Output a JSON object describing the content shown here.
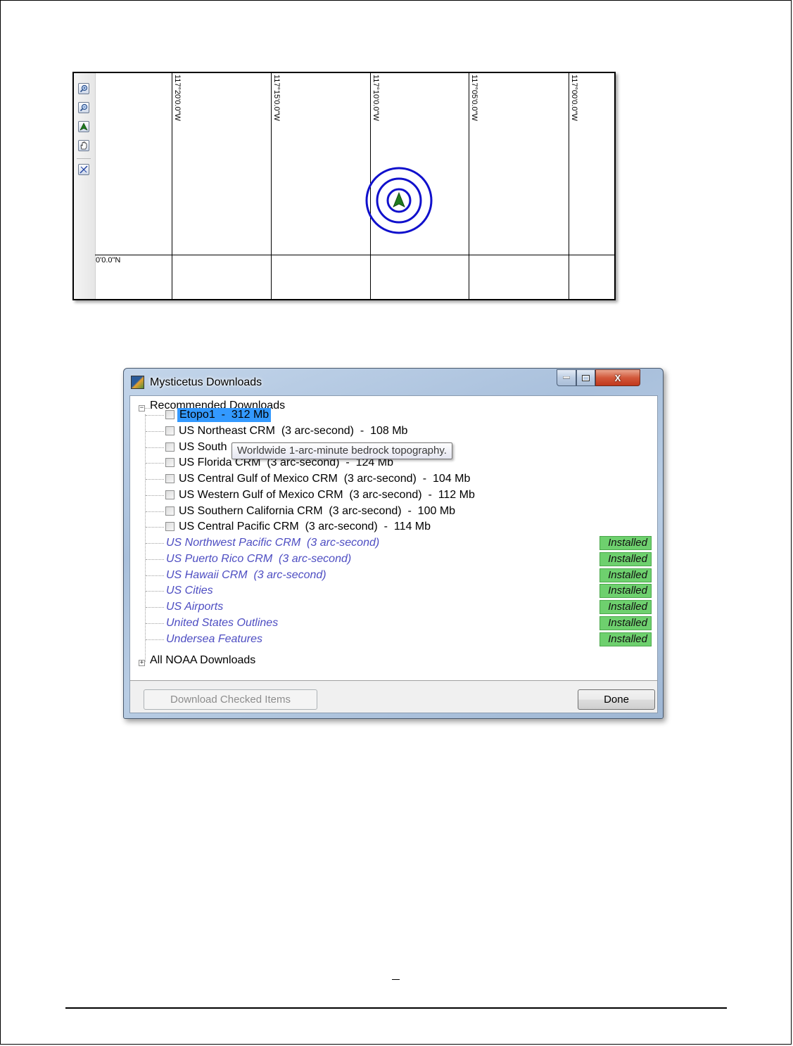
{
  "map": {
    "longitude_labels": [
      "117°20'0.0\"W",
      "117°15'0.0\"W",
      "117°10'0.0\"W",
      "117°05'0.0\"W",
      "117°00'0.0\"W"
    ],
    "latitude_label": "0'0.0\"N",
    "toolbar_icons": [
      "zoom-in-icon",
      "zoom-out-icon",
      "center-marker-icon",
      "pan-hand-icon",
      "measure-icon"
    ],
    "marker": {
      "color": "#1e7a1e",
      "ring_color": "#1010cc"
    }
  },
  "dialog": {
    "title": "Mysticetus Downloads",
    "tree": {
      "root_label": "Recommended Downloads",
      "tooltip": "Worldwide 1-arc-minute bedrock topography.",
      "items": [
        {
          "label": "Etopo1  -  312 Mb",
          "selected": true
        },
        {
          "label": "US Northeast CRM  (3 arc-second)  -  108 Mb"
        },
        {
          "label": "US South"
        },
        {
          "label": "US Florida CRM  (3 arc-second)  -  124 Mb"
        },
        {
          "label": "US Central Gulf of Mexico CRM  (3 arc-second)  -  104 Mb"
        },
        {
          "label": "US Western Gulf of Mexico CRM  (3 arc-second)  -  112 Mb"
        },
        {
          "label": "US Southern California CRM  (3 arc-second)  -  100 Mb"
        },
        {
          "label": "US Central Pacific CRM  (3 arc-second)  -  114 Mb"
        }
      ],
      "installed_items": [
        {
          "label": "US Northwest Pacific CRM  (3 arc-second)",
          "status": "Installed"
        },
        {
          "label": "US Puerto Rico CRM  (3 arc-second)",
          "status": "Installed"
        },
        {
          "label": "US Hawaii CRM  (3 arc-second)",
          "status": "Installed"
        },
        {
          "label": "US Cities",
          "status": "Installed"
        },
        {
          "label": "US Airports",
          "status": "Installed"
        },
        {
          "label": "United States Outlines",
          "status": "Installed"
        },
        {
          "label": "Undersea Features",
          "status": "Installed"
        }
      ],
      "second_root_label": "All NOAA Downloads"
    },
    "buttons": {
      "download_label": "Download Checked Items",
      "done_label": "Done"
    },
    "window_buttons": {
      "close_glyph": "X"
    },
    "colors": {
      "selection": "#3399ff",
      "installed_badge": "#6ed06e",
      "installed_text": "#4d4dc2"
    }
  }
}
